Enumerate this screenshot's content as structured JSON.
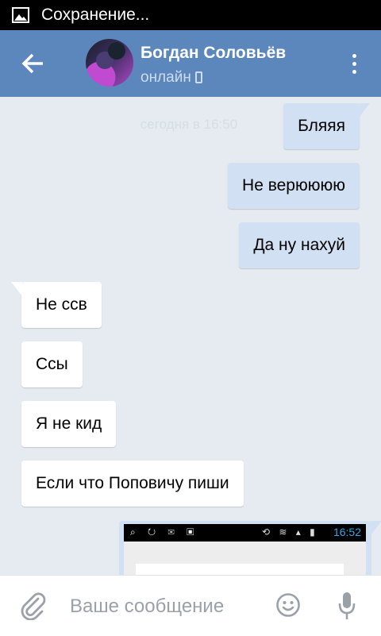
{
  "statusbar": {
    "text": "Сохранение...",
    "icon": "image-icon"
  },
  "header": {
    "contact_name": "Богдан Соловьёв",
    "contact_status": "онлайн",
    "back_icon": "arrow-left-icon",
    "menu_icon": "more-vertical-icon",
    "background": "#5b87bd"
  },
  "chat": {
    "date_separator": "сегодня в 16:50",
    "messages": [
      {
        "direction": "out",
        "text": "Бляяя"
      },
      {
        "direction": "out",
        "text": "Не верюююю"
      },
      {
        "direction": "out",
        "text": "Да ну нахуй"
      },
      {
        "direction": "in",
        "text": "Не ссв"
      },
      {
        "direction": "in",
        "text": "Ссы"
      },
      {
        "direction": "in",
        "text": "Я не кид"
      },
      {
        "direction": "in",
        "text": "Если что Поповичу пиши"
      }
    ],
    "image_attachment": {
      "status_time": "16:52"
    },
    "outgoing_color": "#d1e0f2",
    "incoming_color": "#ffffff"
  },
  "compose": {
    "placeholder": "Ваше сообщение",
    "attach_icon": "paperclip-icon",
    "emoji_icon": "smiley-icon",
    "mic_icon": "microphone-icon"
  }
}
